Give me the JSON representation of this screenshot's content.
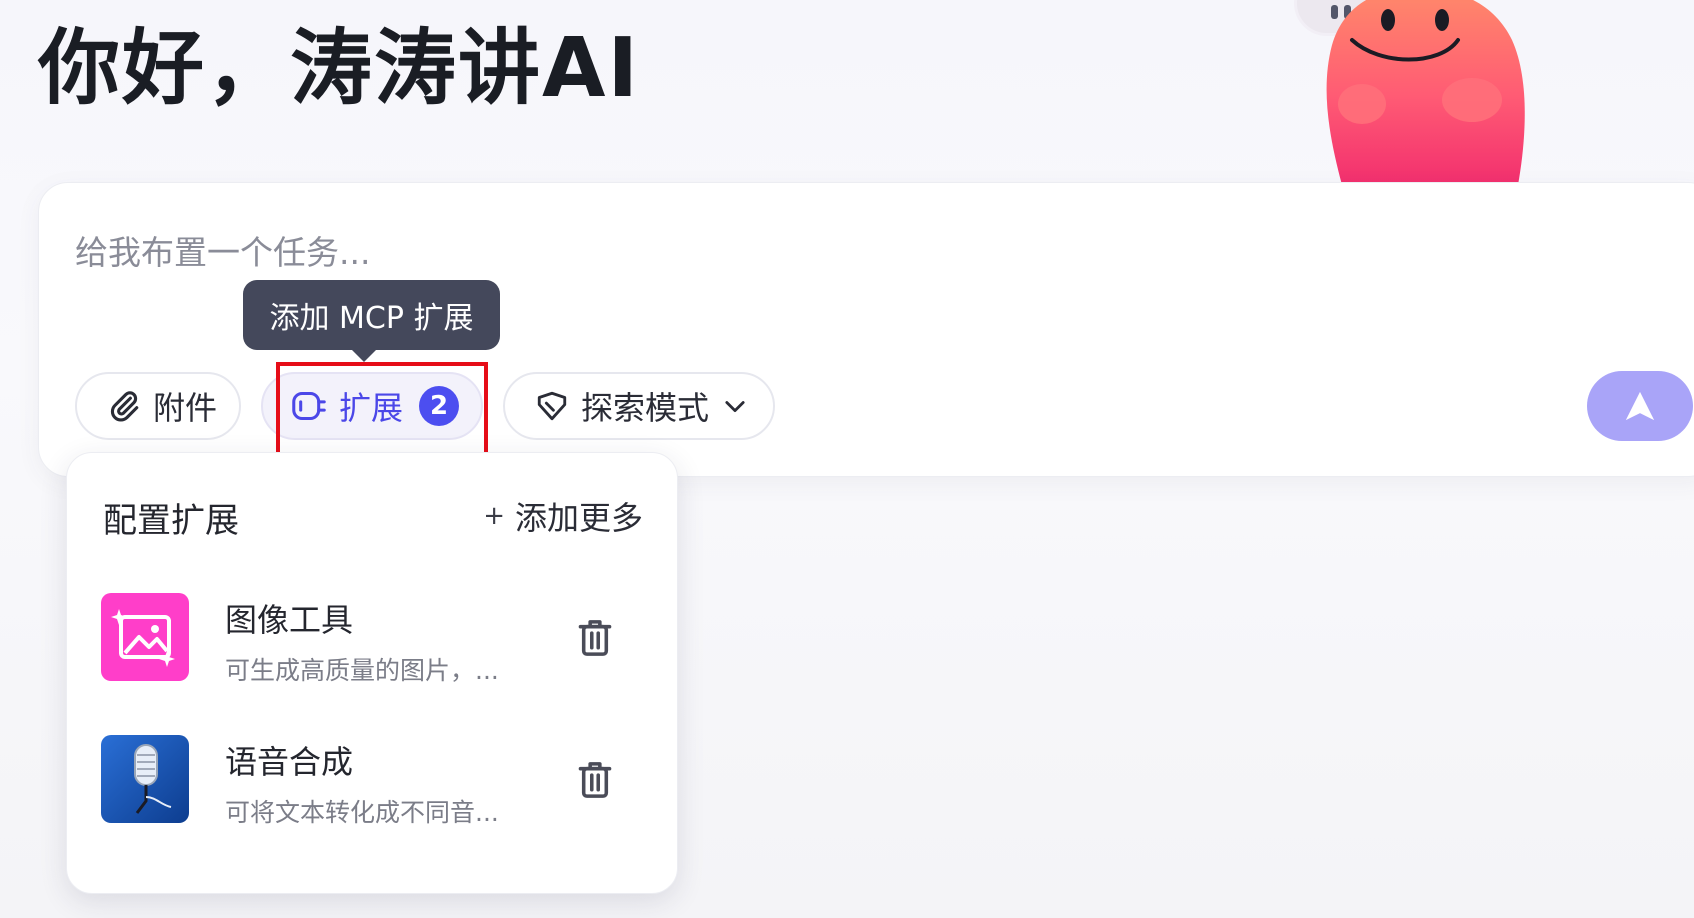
{
  "greeting": "你好，涛涛讲AI",
  "composer": {
    "placeholder": "给我布置一个任务..."
  },
  "toolbar": {
    "attach_label": "附件",
    "extension_label": "扩展",
    "extension_count": "2",
    "explore_label": "探索模式",
    "tooltip": "添加 MCP 扩展"
  },
  "panel": {
    "title": "配置扩展",
    "add_more_label": "添加更多",
    "items": [
      {
        "name": "图像工具",
        "description": "可生成高质量的图片，...",
        "icon": "image-sparkle-icon"
      },
      {
        "name": "语音合成",
        "description": "可将文本转化成不同音...",
        "icon": "microphone-icon"
      }
    ]
  },
  "colors": {
    "accent": "#4c4ef0",
    "send_button": "#a9a4f8",
    "highlight": "#e60d18",
    "tooltip_bg": "#44485b",
    "image_tool_bg": "#ff3ec9"
  }
}
